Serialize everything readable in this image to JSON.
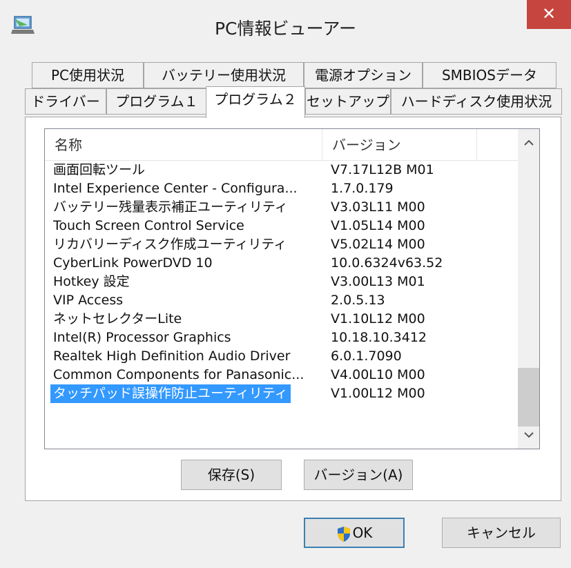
{
  "window": {
    "title": "PC情報ビューアー",
    "close_label": "✕"
  },
  "tabs_row1": [
    "PC使用状況",
    "バッテリー使用状況",
    "電源オプション",
    "SMBIOSデータ"
  ],
  "tabs_row2": [
    "ドライバー",
    "プログラム１",
    "プログラム２",
    "セットアップ",
    "ハードディスク使用状況"
  ],
  "selected_tab": "プログラム２",
  "list": {
    "columns": [
      "名称",
      "バージョン"
    ],
    "rows": [
      {
        "name": "画面回転ツール",
        "version": "V7.17L12B M01"
      },
      {
        "name": "Intel Experience Center - Configura...",
        "version": "1.7.0.179"
      },
      {
        "name": "バッテリー残量表示補正ユーティリティ",
        "version": "V3.03L11 M00"
      },
      {
        "name": "Touch Screen Control Service",
        "version": "V1.05L14 M00"
      },
      {
        "name": "リカバリーディスク作成ユーティリティ",
        "version": "V5.02L14 M00"
      },
      {
        "name": "CyberLink PowerDVD 10",
        "version": "10.0.6324v63.52"
      },
      {
        "name": "Hotkey 設定",
        "version": "V3.00L13 M01"
      },
      {
        "name": "VIP Access",
        "version": "2.0.5.13"
      },
      {
        "name": "ネットセレクターLite",
        "version": "V1.10L12 M00"
      },
      {
        "name": "Intel(R) Processor Graphics",
        "version": "10.18.10.3412"
      },
      {
        "name": "Realtek High Definition Audio Driver",
        "version": "6.0.1.7090"
      },
      {
        "name": "Common Components for Panasonic...",
        "version": "V4.00L10 M00"
      },
      {
        "name": "タッチパッド誤操作防止ユーティリティ",
        "version": "V1.00L12 M00"
      }
    ],
    "selected_row_index": 12,
    "scroll_up_icon": "chevron-up-icon",
    "scroll_down_icon": "chevron-down-icon"
  },
  "buttons": {
    "save": "保存(S)",
    "version": "バージョン(A)",
    "ok": "OK",
    "cancel": "キャンセル"
  },
  "colors": {
    "selection": "#3399ff",
    "close_button": "#c7453f",
    "default_button_border": "#3c7fb1"
  }
}
